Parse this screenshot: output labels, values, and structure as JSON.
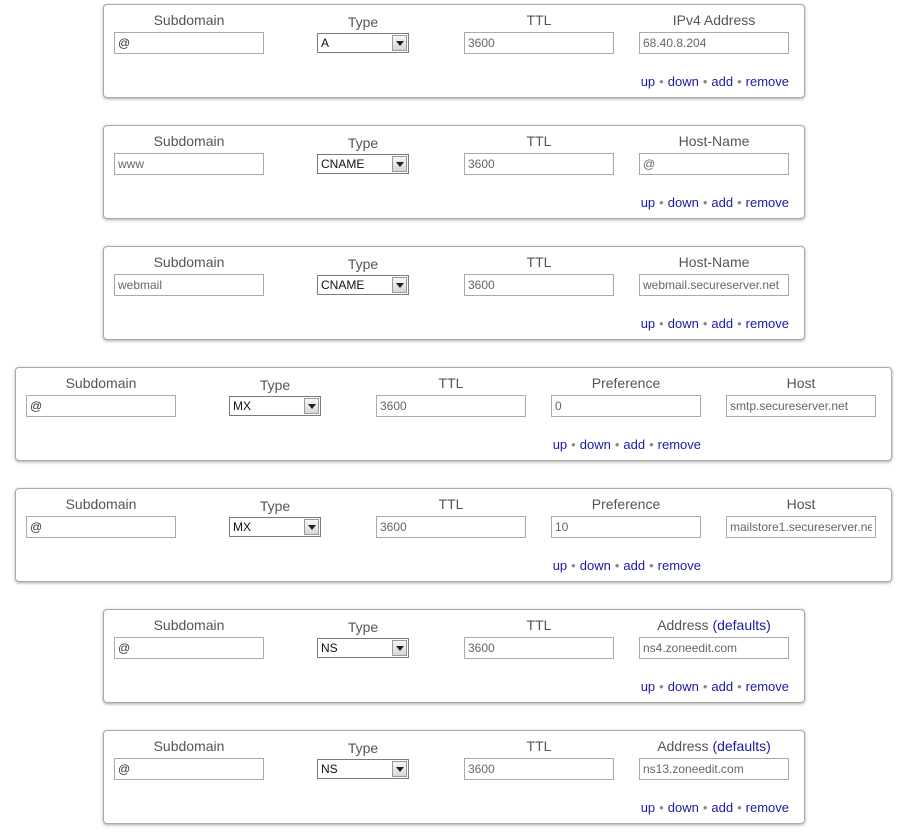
{
  "actions": {
    "up": "up",
    "down": "down",
    "add": "add",
    "remove": "remove",
    "sep": "•"
  },
  "records": [
    {
      "subdomain_label": "Subdomain",
      "subdomain": "@",
      "type_label": "Type",
      "type": "A",
      "ttl_label": "TTL",
      "ttl": "3600",
      "col4_label": "IPv4 Address",
      "col4": "68.40.8.204"
    },
    {
      "subdomain_label": "Subdomain",
      "subdomain": "www",
      "type_label": "Type",
      "type": "CNAME",
      "ttl_label": "TTL",
      "ttl": "3600",
      "col4_label": "Host-Name",
      "col4": "@"
    },
    {
      "subdomain_label": "Subdomain",
      "subdomain": "webmail",
      "type_label": "Type",
      "type": "CNAME",
      "ttl_label": "TTL",
      "ttl": "3600",
      "col4_label": "Host-Name",
      "col4": "webmail.secureserver.net"
    },
    {
      "subdomain_label": "Subdomain",
      "subdomain": "@",
      "type_label": "Type",
      "type": "MX",
      "ttl_label": "TTL",
      "ttl": "3600",
      "col4_label": "Preference",
      "col4": "0",
      "col5_label": "Host",
      "col5": "smtp.secureserver.net"
    },
    {
      "subdomain_label": "Subdomain",
      "subdomain": "@",
      "type_label": "Type",
      "type": "MX",
      "ttl_label": "TTL",
      "ttl": "3600",
      "col4_label": "Preference",
      "col4": "10",
      "col5_label": "Host",
      "col5": "mailstore1.secureserver.net"
    },
    {
      "subdomain_label": "Subdomain",
      "subdomain": "@",
      "type_label": "Type",
      "type": "NS",
      "ttl_label": "TTL",
      "ttl": "3600",
      "col4_label": "Address",
      "col4_link": "(defaults)",
      "col4": "ns4.zoneedit.com"
    },
    {
      "subdomain_label": "Subdomain",
      "subdomain": "@",
      "type_label": "Type",
      "type": "NS",
      "ttl_label": "TTL",
      "ttl": "3600",
      "col4_label": "Address",
      "col4_link": "(defaults)",
      "col4": "ns13.zoneedit.com"
    }
  ]
}
